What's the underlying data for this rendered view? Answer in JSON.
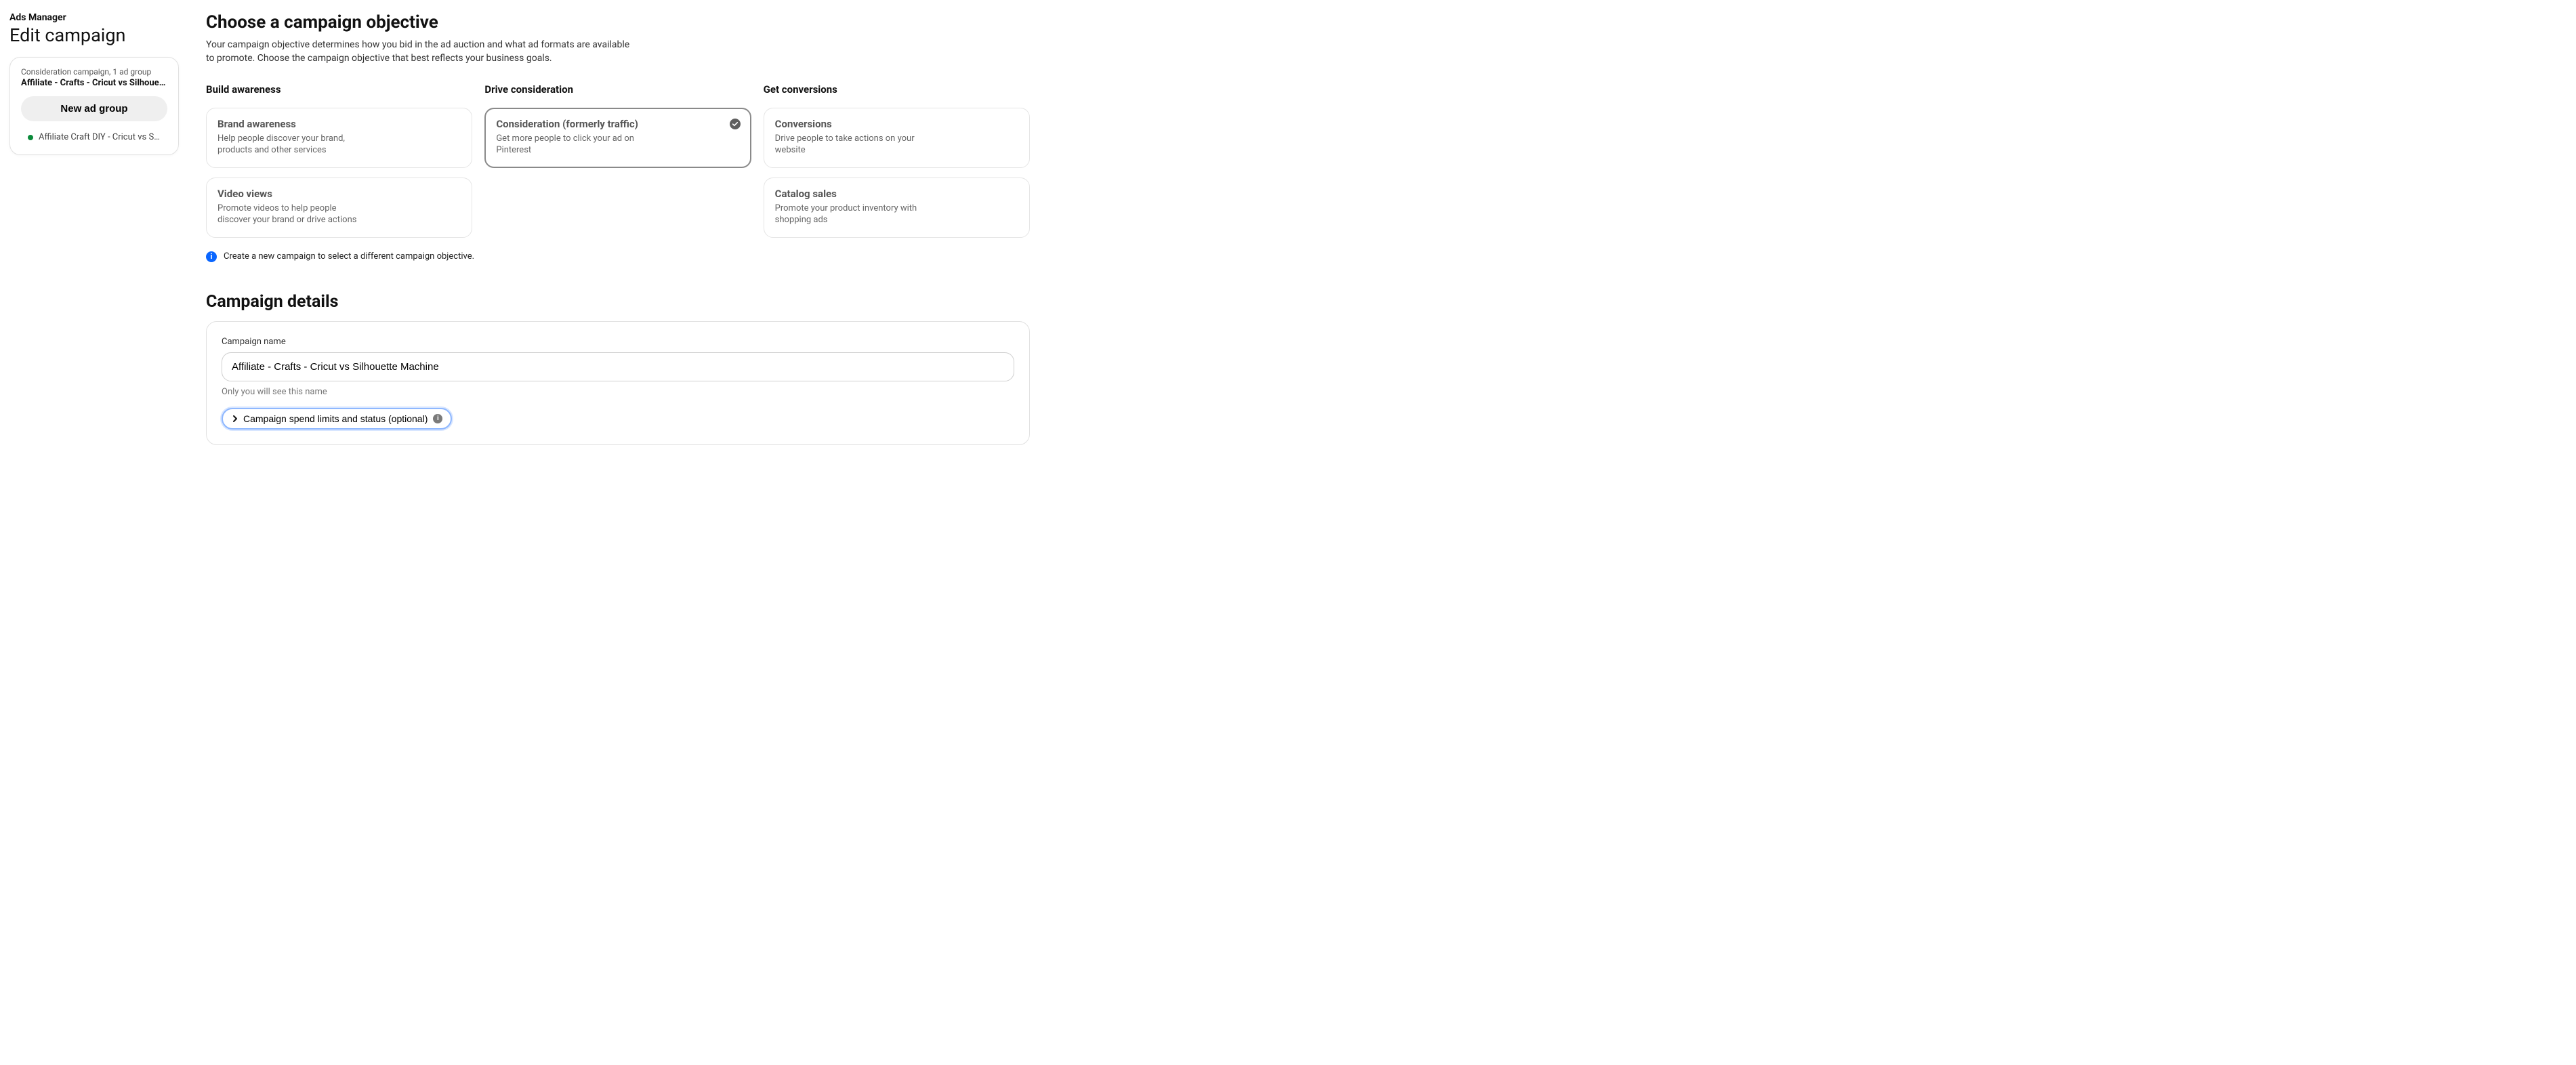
{
  "header": {
    "breadcrumb": "Ads Manager",
    "title": "Edit campaign"
  },
  "sidebar": {
    "campaign_meta": "Consideration campaign, 1 ad group",
    "campaign_name": "Affiliate - Crafts - Cricut vs Silhouet...",
    "new_adgroup_label": "New ad group",
    "adgroups": [
      {
        "name": "Affiliate Craft DIY - Cricut vs Silh...",
        "status": "active"
      }
    ]
  },
  "objective_section": {
    "heading": "Choose a campaign objective",
    "lead": "Your campaign objective determines how you bid in the ad auction and what ad formats are available to promote. Choose the campaign objective that best reflects your business goals.",
    "columns": [
      {
        "label": "Build awareness",
        "cards": [
          {
            "id": "brand-awareness",
            "title": "Brand awareness",
            "desc": "Help people discover your brand, products and other services",
            "selected": false
          },
          {
            "id": "video-views",
            "title": "Video views",
            "desc": "Promote videos to help people discover your brand or drive actions",
            "selected": false
          }
        ]
      },
      {
        "label": "Drive consideration",
        "cards": [
          {
            "id": "consideration",
            "title": "Consideration (formerly traffic)",
            "desc": "Get more people to click your ad on Pinterest",
            "selected": true
          }
        ]
      },
      {
        "label": "Get conversions",
        "cards": [
          {
            "id": "conversions",
            "title": "Conversions",
            "desc": "Drive people to take actions on your website",
            "selected": false
          },
          {
            "id": "catalog-sales",
            "title": "Catalog sales",
            "desc": "Promote your product inventory with shopping ads",
            "selected": false
          }
        ]
      }
    ],
    "info_text": "Create a new campaign to select a different campaign objective."
  },
  "details_section": {
    "heading": "Campaign details",
    "name_label": "Campaign name",
    "name_value": "Affiliate - Crafts - Cricut vs Silhouette Machine",
    "name_helper": "Only you will see this name",
    "accordion_label": "Campaign spend limits and status (optional)"
  },
  "colors": {
    "accent_blue": "#0a66ff",
    "focus_ring": "#8fb8ff",
    "status_green": "#0a8a3a"
  }
}
